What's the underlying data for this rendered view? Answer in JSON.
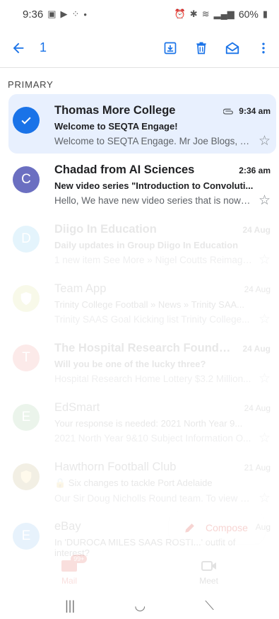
{
  "status_bar": {
    "time": "9:36",
    "battery": "60%"
  },
  "app_bar": {
    "selected_count": "1",
    "icons": [
      "back-arrow-icon",
      "archive-icon",
      "delete-icon",
      "mark-unread-icon",
      "more-vert-icon"
    ]
  },
  "section_label": "PRIMARY",
  "emails": [
    {
      "sender": "Thomas More College",
      "time": "9:34 am",
      "subject": "Welcome to SEQTA Engage!",
      "snippet": "Welcome to SEQTA Engage. Mr Joe Blogs, T...",
      "avatar_letter": "",
      "avatar_color": "#1a73e8",
      "selected": true,
      "unread": true,
      "has_attachment": true
    },
    {
      "sender": "Chadad from AI Sciences",
      "time": "2:36 am",
      "subject": "New video series \"Introduction to Convoluti...",
      "snippet": "Hello, We have new video series that is now r...",
      "avatar_letter": "C",
      "avatar_color": "#6b6fc1",
      "selected": false,
      "unread": true
    },
    {
      "sender": "Diigo In Education",
      "time": "24 Aug",
      "subject": "Daily updates in Group Diigo In Education",
      "snippet": "1 new item See More » Nigel Coutts Reimagi...",
      "avatar_letter": "D",
      "avatar_color": "#039be5",
      "unread": true
    },
    {
      "sender": "Team App",
      "time": "24 Aug",
      "subject": "Trinity College Football » News » Trinity SAA...",
      "snippet": "Trinity SAAS Goal Kicking list Trinity College...",
      "avatar_letter": "",
      "avatar_color": "#7cb342",
      "unread": false
    },
    {
      "sender": "The Hospital Research Foundati...",
      "time": "24 Aug",
      "subject": "Will you be one of the lucky three?",
      "snippet": "Hospital Research Home Lottery $3.2 Million...",
      "avatar_letter": "T",
      "avatar_color": "#e53935",
      "unread": true
    },
    {
      "sender": "EdSmart",
      "time": "24 Aug",
      "subject": "Your response is needed: 2021 North Year 9...",
      "snippet": "2021 North Year 9&10 Subject Information O...",
      "avatar_letter": "E",
      "avatar_color": "#43a047",
      "unread": false
    },
    {
      "sender": "Hawthorn Football Club",
      "time": "21 Aug",
      "subject": "🔒 Six changes to tackle Port Adelaide",
      "snippet": "Our Sir Doug Nicholls Round team. To view th...",
      "avatar_letter": "",
      "avatar_color": "#8d6e00",
      "unread": false
    },
    {
      "sender": "eBay",
      "time": "Aug",
      "subject": "In 'DUROCA MILES SAAS ROSTI...' outfit of interest?",
      "snippet": "",
      "avatar_letter": "E",
      "avatar_color": "#1e88e5",
      "unread": false
    }
  ],
  "compose": {
    "label": "Compose"
  },
  "bottom_nav": {
    "mail_label": "Mail",
    "mail_badge": "99+",
    "meet_label": "Meet"
  }
}
